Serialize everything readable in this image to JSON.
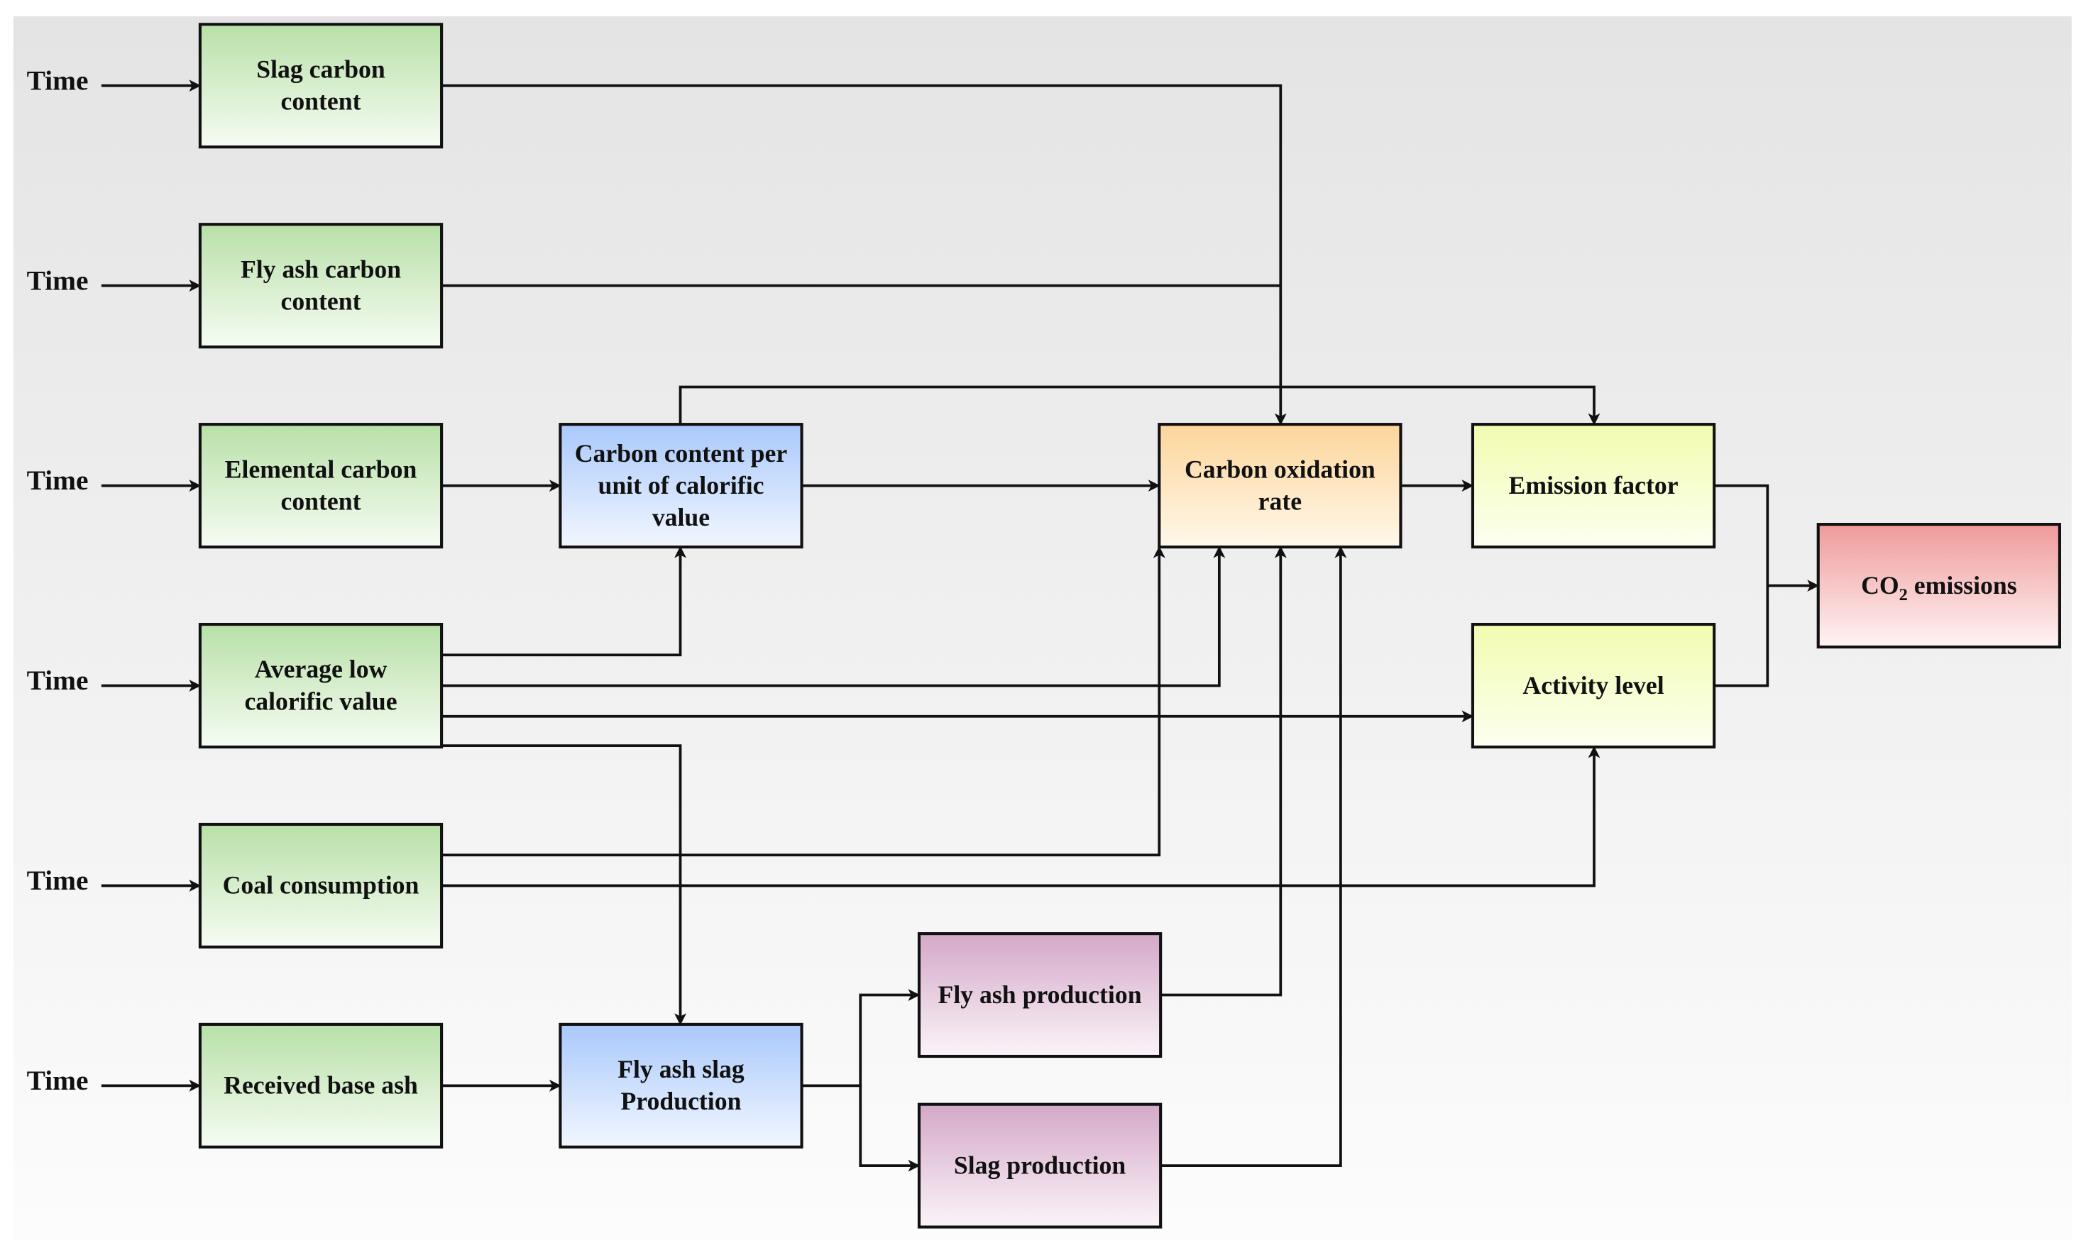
{
  "diagram": {
    "time_label": "Time",
    "inputs": [
      {
        "id": "slag_carbon",
        "lines": [
          "Slag carbon",
          "content"
        ],
        "color": "green"
      },
      {
        "id": "flyash_carbon",
        "lines": [
          "Fly ash carbon",
          "content"
        ],
        "color": "green"
      },
      {
        "id": "elemental_carbon",
        "lines": [
          "Elemental carbon",
          "content"
        ],
        "color": "green"
      },
      {
        "id": "avg_low_cal",
        "lines": [
          "Average low",
          "calorific value"
        ],
        "color": "green"
      },
      {
        "id": "coal_consumption",
        "lines": [
          "Coal consumption"
        ],
        "color": "green"
      },
      {
        "id": "received_base_ash",
        "lines": [
          "Received base ash"
        ],
        "color": "green"
      }
    ],
    "nodes": {
      "carbon_per_cal": {
        "lines": [
          "Carbon content per",
          "unit of calorific",
          "value"
        ],
        "color": "blue"
      },
      "flyash_slag_prod": {
        "lines": [
          "Fly ash slag",
          "Production"
        ],
        "color": "blue"
      },
      "carbon_oxidation": {
        "lines": [
          "Carbon oxidation",
          "rate"
        ],
        "color": "orange"
      },
      "emission_factor": {
        "lines": [
          "Emission factor"
        ],
        "color": "yellow"
      },
      "activity_level": {
        "lines": [
          "Activity level"
        ],
        "color": "yellow"
      },
      "flyash_prod": {
        "lines": [
          "Fly ash production"
        ],
        "color": "purple"
      },
      "slag_prod": {
        "lines": [
          "Slag production"
        ],
        "color": "purple"
      },
      "co2": {
        "main": "CO",
        "sub": "2",
        "rest": " emissions",
        "color": "red"
      }
    },
    "colors": {
      "green": [
        "#b8e0a8",
        "#f6fcf3"
      ],
      "blue": [
        "#a9c8fb",
        "#f2f7ff"
      ],
      "orange": [
        "#fcd59a",
        "#fff8ea"
      ],
      "yellow": [
        "#f2fcb0",
        "#fcfff0"
      ],
      "purple": [
        "#d4a8c8",
        "#fbf4f9"
      ],
      "red": [
        "#ef9a9a",
        "#fff4f4"
      ]
    },
    "edges": [
      [
        "slag_carbon",
        "carbon_oxidation"
      ],
      [
        "flyash_carbon",
        "carbon_oxidation"
      ],
      [
        "elemental_carbon",
        "carbon_per_cal"
      ],
      [
        "carbon_per_cal",
        "carbon_oxidation"
      ],
      [
        "carbon_per_cal",
        "emission_factor"
      ],
      [
        "avg_low_cal",
        "carbon_per_cal"
      ],
      [
        "avg_low_cal",
        "carbon_oxidation"
      ],
      [
        "avg_low_cal",
        "activity_level"
      ],
      [
        "avg_low_cal",
        "flyash_slag_prod"
      ],
      [
        "coal_consumption",
        "carbon_oxidation"
      ],
      [
        "coal_consumption",
        "activity_level"
      ],
      [
        "received_base_ash",
        "flyash_slag_prod"
      ],
      [
        "flyash_slag_prod",
        "flyash_prod"
      ],
      [
        "flyash_slag_prod",
        "slag_prod"
      ],
      [
        "flyash_prod",
        "carbon_oxidation"
      ],
      [
        "slag_prod",
        "carbon_oxidation"
      ],
      [
        "carbon_oxidation",
        "emission_factor"
      ],
      [
        "emission_factor",
        "co2"
      ],
      [
        "activity_level",
        "co2"
      ]
    ]
  }
}
